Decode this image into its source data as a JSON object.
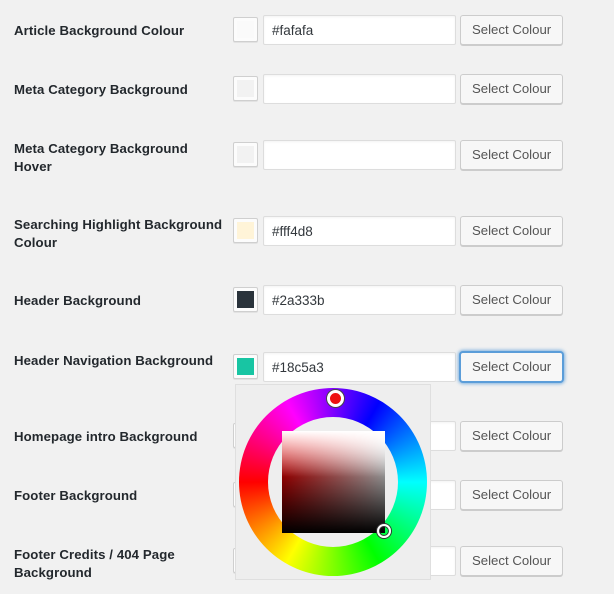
{
  "page": {
    "background_color": "#f1f1f1",
    "button_label": "Select Colour",
    "accent_focus_color": "#5b9dd9"
  },
  "rows": [
    {
      "label": "Article Background Colour",
      "value": "#fafafa",
      "swatch_color": "#fafafa",
      "button_label": "Select Colour",
      "focused": false
    },
    {
      "label": "Meta Category Background",
      "value": "",
      "swatch_color": "#f2f2f2",
      "button_label": "Select Colour",
      "focused": false
    },
    {
      "label": "Meta Category Background Hover",
      "value": "",
      "swatch_color": "#f2f2f2",
      "button_label": "Select Colour",
      "focused": false
    },
    {
      "label": "Searching Highlight Background Colour",
      "value": "#fff4d8",
      "swatch_color": "#fff4d8",
      "button_label": "Select Colour",
      "focused": false
    },
    {
      "label": "Header Background",
      "value": "#2a333b",
      "swatch_color": "#2a333b",
      "button_label": "Select Colour",
      "focused": false
    },
    {
      "label": "Header Navigation Background",
      "value": "#18c5a3",
      "swatch_color": "#18c5a3",
      "button_label": "Select Colour",
      "focused": true
    },
    {
      "label": "Homepage intro Background",
      "value": "",
      "swatch_color": "#f2f2f2",
      "button_label": "Select Colour",
      "focused": false
    },
    {
      "label": "Footer Background",
      "value": "",
      "swatch_color": "#f2f2f2",
      "button_label": "Select Colour",
      "focused": false
    },
    {
      "label": "Footer Credits / 404 Page Background",
      "value": "",
      "swatch_color": "#f2f2f2",
      "button_label": "Select Colour",
      "focused": false
    }
  ],
  "color_picker": {
    "open": true,
    "opened_for_row": "Header Navigation Background",
    "hue_marker_color": "#ee1111",
    "selected_hue_degrees": 0,
    "sv_marker_position": "bottom-right",
    "panel_background": "#eeeeee"
  }
}
